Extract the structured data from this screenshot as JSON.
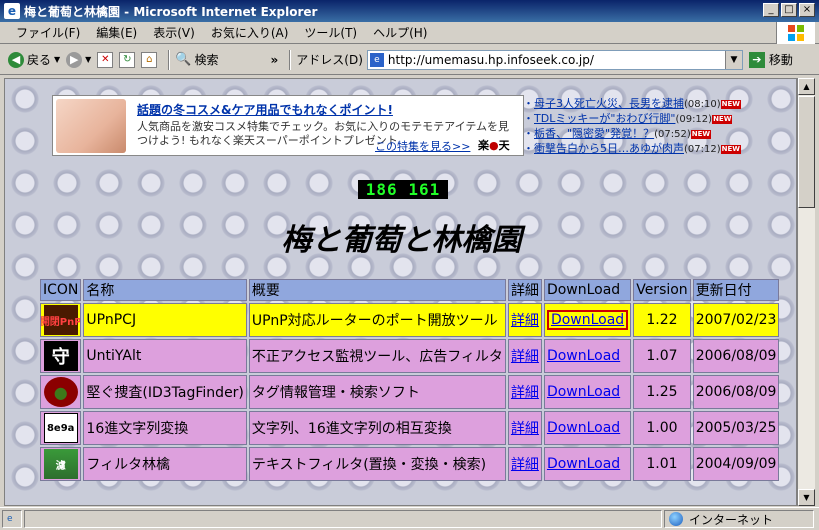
{
  "window": {
    "title": "梅と葡萄と林檎園 - Microsoft Internet Explorer",
    "buttons": [
      "_",
      "□",
      "×"
    ]
  },
  "menu": [
    "ファイル(F)",
    "編集(E)",
    "表示(V)",
    "お気に入り(A)",
    "ツール(T)",
    "ヘルプ(H)"
  ],
  "toolbar": {
    "back": "戻る",
    "search": "検索",
    "more": "»",
    "address_label": "アドレス(D)",
    "address": "http://umemasu.hp.infoseek.co.jp/",
    "go": "移動"
  },
  "ad": {
    "headline": "話題の冬コスメ&ケア用品でもれなくポイント!",
    "body": "人気商品を激安コスメ特集でチェック。お気に入りのモテモテアイテムを見つけよう! もれなく楽天スーパーポイントプレゼント",
    "more": "この特集を見る>>",
    "brand_prefix": "楽",
    "brand_suffix": "天"
  },
  "news": [
    {
      "text": "母子3人死亡火災、長男を逮捕",
      "time": "(08:10)",
      "badge": "NEW"
    },
    {
      "text": "TDLミッキーが\"おわび行脚\"",
      "time": "(09:12)",
      "badge": "NEW"
    },
    {
      "text": "栃香、\"隠密愛\"発覚！？",
      "time": "(07:52)",
      "badge": "NEW"
    },
    {
      "text": "衝撃告白から5日…あゆが肉声",
      "time": "(07:12)",
      "badge": "NEW"
    }
  ],
  "counter": "186 161",
  "site_title": "梅と葡萄と林檎園",
  "table": {
    "headers": [
      "ICON",
      "名称",
      "概要",
      "詳細",
      "DownLoad",
      "Version",
      "更新日付"
    ],
    "rows": [
      {
        "icon": "開閉PnP",
        "name": "UPnPCJ",
        "desc": "UPnP対応ルーターのポート開放ツール",
        "detail": "詳細",
        "download": "DownLoad",
        "version": "1.22",
        "date": "2007/02/23"
      },
      {
        "icon": "守",
        "name": "UntiYAlt",
        "desc": "不正アクセス監視ツール、広告フィルタ",
        "detail": "詳細",
        "download": "DownLoad",
        "version": "1.07",
        "date": "2006/08/09"
      },
      {
        "icon": "●",
        "name": "堅ぐ捜査(ID3TagFinder)",
        "desc": "タグ情報管理・検索ソフト",
        "detail": "詳細",
        "download": "DownLoad",
        "version": "1.25",
        "date": "2006/08/09"
      },
      {
        "icon": "8e9a",
        "name": "16進文字列変換",
        "desc": "文字列、16進文字列の相互変換",
        "detail": "詳細",
        "download": "DownLoad",
        "version": "1.00",
        "date": "2005/03/25"
      },
      {
        "icon": "濾",
        "name": "フィルタ林檎",
        "desc": "テキストフィルタ(置換・変換・検索)",
        "detail": "詳細",
        "download": "DownLoad",
        "version": "1.01",
        "date": "2004/09/09"
      }
    ]
  },
  "status": {
    "zone": "インターネット"
  },
  "colors": {
    "row_highlight": "#ffff00",
    "row_normal": "#dda0dd",
    "header": "#90a7dd"
  }
}
